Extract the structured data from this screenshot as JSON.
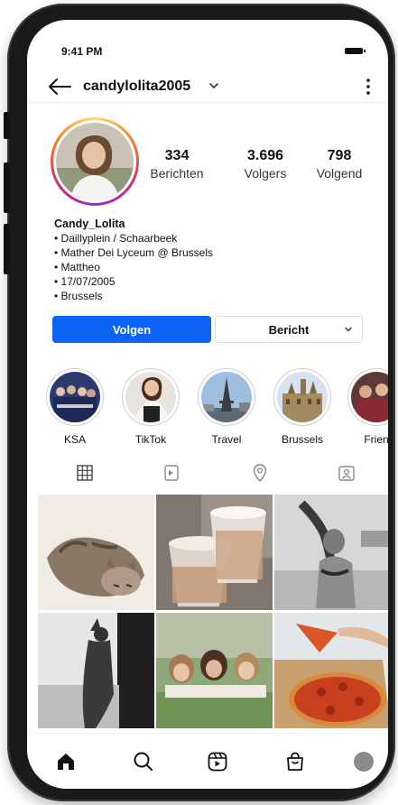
{
  "status_bar": {
    "time": "9:41 PM"
  },
  "header": {
    "username": "candylolita2005"
  },
  "stats": [
    {
      "value": "334",
      "label": "Berichten"
    },
    {
      "value": "3.696",
      "label": "Volgers"
    },
    {
      "value": "798",
      "label": "Volgend"
    }
  ],
  "bio": {
    "name": "Candy_Lolita",
    "lines": [
      "• Daillyplein / Schaarbeek",
      "• Mather Dei Lyceum @ Brussels",
      "• Mattheo",
      "• 17/07/2005",
      "• Brussels"
    ]
  },
  "actions": {
    "follow_label": "Volgen",
    "message_label": "Bericht"
  },
  "highlights": [
    {
      "label": "KSA"
    },
    {
      "label": "TikTok"
    },
    {
      "label": "Travel"
    },
    {
      "label": "Brussels"
    },
    {
      "label": "Frien"
    }
  ],
  "colors": {
    "accent": "#0d63f6",
    "story_ring": "#d62976"
  },
  "icons": {
    "tabs": [
      "grid-icon",
      "reels-tab-icon",
      "location-icon",
      "tagged-icon"
    ],
    "nav": [
      "home-icon",
      "search-icon",
      "reels-icon",
      "shop-icon",
      "profile-icon"
    ]
  }
}
